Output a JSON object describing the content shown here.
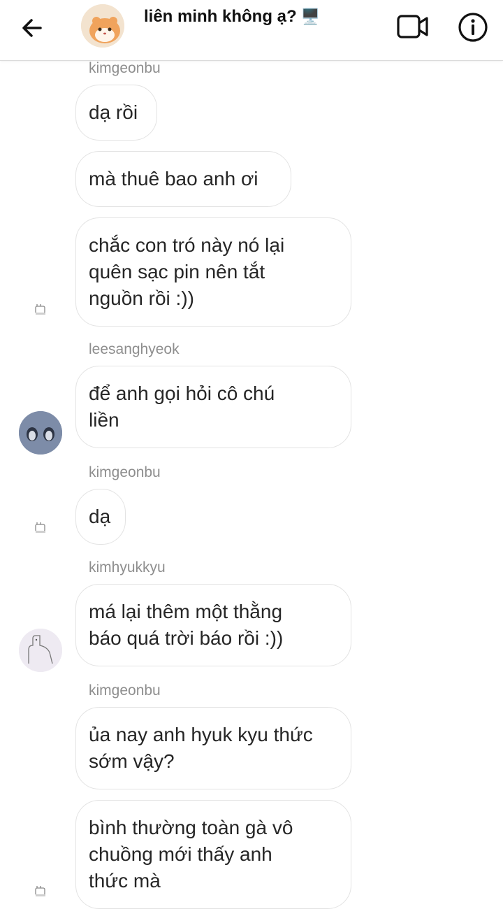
{
  "header": {
    "title": "liên minh không ạ?",
    "title_emoji": "🖥️",
    "back_icon": "arrow-left-icon",
    "video_icon": "video-camera-icon",
    "info_icon": "info-icon"
  },
  "messages": [
    {
      "sender": "kimgeonbu",
      "text": "dạ rồi"
    },
    {
      "text": "mà thuê bao anh ơi"
    },
    {
      "text": "chắc con tró này nó lại\nquên sạc pin nên tắt\nnguồn rồi :))"
    },
    {
      "sender": "leesanghyeok",
      "text": "để anh gọi hỏi cô chú\nliền"
    },
    {
      "sender": "kimgeonbu",
      "text": "dạ"
    },
    {
      "sender": "kimhyukkyu",
      "text": "má lại thêm một thằng\nbáo quá trời báo rồi :))"
    },
    {
      "sender": "kimgeonbu",
      "text": "ủa nay anh hyuk kyu thức\nsớm vậy?"
    },
    {
      "text": "bình thường toàn gà vô\nchuồng mới thấy anh\nthức mà"
    }
  ],
  "colors": {
    "bubble_border": "#e3e3e3",
    "sender_text": "#8e8e8e",
    "message_text": "#262626"
  }
}
